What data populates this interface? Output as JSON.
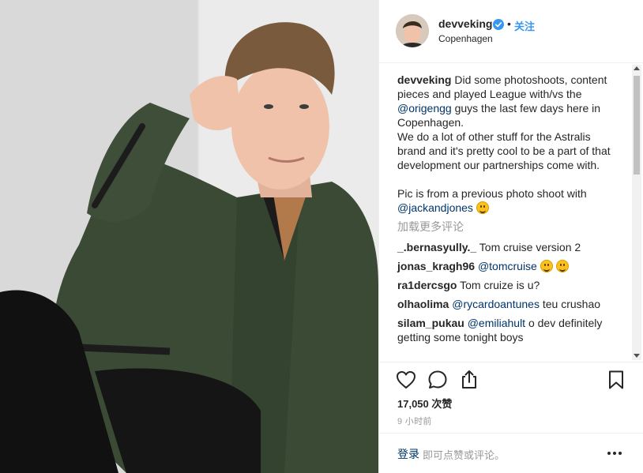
{
  "post": {
    "username": "devveking",
    "location": "Copenhagen",
    "follow_label": "关注",
    "separator": "•",
    "caption": {
      "author": "devveking",
      "text_1": " Did some photoshoots, content pieces and played League with/vs the ",
      "mention_1": "@origengg",
      "text_2": " guys the last few days here in Copenhagen.\nWe do a lot of other stuff for the Astralis brand and it's pretty cool to be a part of that development our partnerships come with.\n\nPic is from a previous photo shoot with ",
      "mention_2": "@jackandjones"
    },
    "load_more_label": "加载更多评论",
    "comments": [
      {
        "user": "_.bernasyully._",
        "text": " Tom cruise version 2",
        "mention": "",
        "after": ""
      },
      {
        "user": "jonas_kragh96",
        "text": " ",
        "mention": "@tomcruise",
        "after": " "
      },
      {
        "user": "ra1dercsgo",
        "text": " Tom cruize is u?",
        "mention": "",
        "after": ""
      },
      {
        "user": "olhaolima",
        "text": " ",
        "mention": "@rycardoantunes",
        "after": " teu crushao"
      },
      {
        "user": "silam_pukau",
        "text": " ",
        "mention": "@emiliahult",
        "after": " o dev definitely getting some tonight boys"
      }
    ],
    "likes": "17,050 次赞",
    "timestamp": "9 小时前",
    "login_link": "登录",
    "login_suffix": " 即可点赞或评论。"
  },
  "icons": {
    "like": "heart-icon",
    "comment": "comment-icon",
    "share": "share-icon",
    "save": "bookmark-icon",
    "more": "more-options-icon",
    "verified": "verified-badge-icon"
  },
  "colors": {
    "link": "#003569",
    "follow": "#3897f0",
    "verified": "#3897f0",
    "muted": "#999999",
    "jacket": "#3b4a35"
  }
}
